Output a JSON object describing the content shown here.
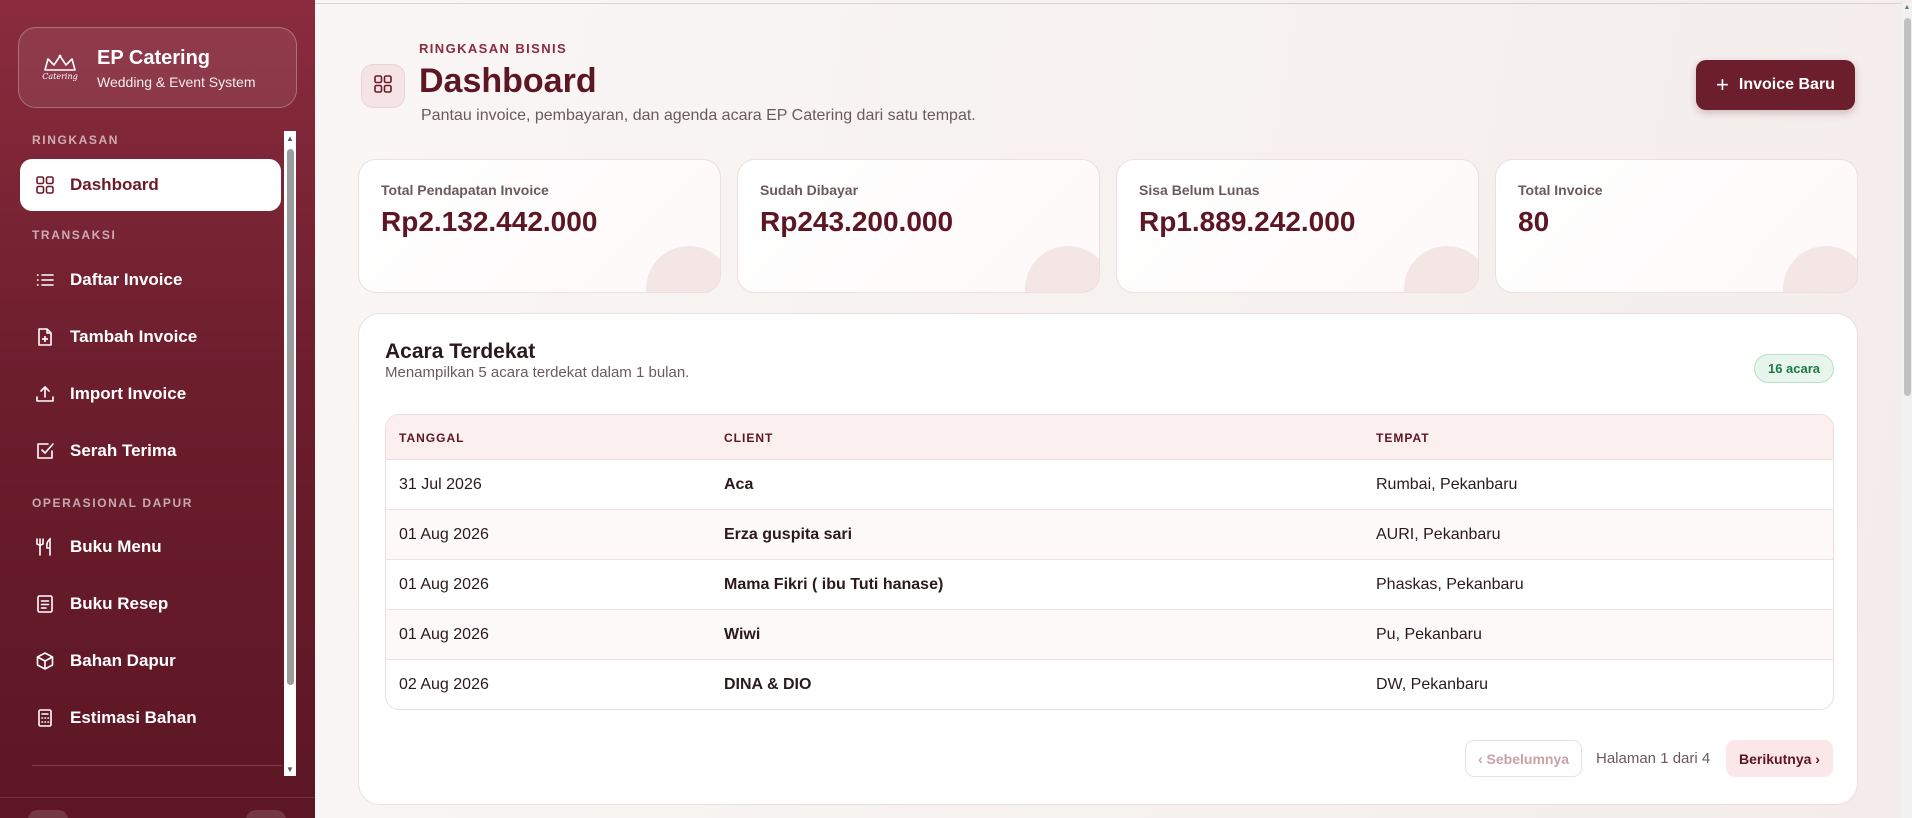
{
  "brand": {
    "title": "EP Catering",
    "subtitle": "Wedding & Event System",
    "logo_word": "Catering"
  },
  "nav": {
    "sections": [
      "RINGKASAN",
      "TRANSAKSI",
      "OPERASIONAL DAPUR"
    ],
    "items": [
      {
        "label": "Dashboard",
        "icon": "grid-icon",
        "active": true
      },
      {
        "label": "Daftar Invoice",
        "icon": "list-icon"
      },
      {
        "label": "Tambah Invoice",
        "icon": "file-plus-icon"
      },
      {
        "label": "Import Invoice",
        "icon": "upload-icon"
      },
      {
        "label": "Serah Terima",
        "icon": "check-square-icon"
      },
      {
        "label": "Buku Menu",
        "icon": "utensils-icon"
      },
      {
        "label": "Buku Resep",
        "icon": "recipe-book-icon"
      },
      {
        "label": "Bahan Dapur",
        "icon": "box-icon"
      },
      {
        "label": "Estimasi Bahan",
        "icon": "calculator-icon"
      }
    ]
  },
  "header": {
    "eyebrow": "RINGKASAN BISNIS",
    "title": "Dashboard",
    "subtitle": "Pantau invoice, pembayaran, dan agenda acara EP Catering dari satu tempat.",
    "new_button": "Invoice Baru"
  },
  "stats": [
    {
      "label": "Total Pendapatan Invoice",
      "value": "Rp2.132.442.000"
    },
    {
      "label": "Sudah Dibayar",
      "value": "Rp243.200.000"
    },
    {
      "label": "Sisa Belum Lunas",
      "value": "Rp1.889.242.000"
    },
    {
      "label": "Total Invoice",
      "value": "80"
    }
  ],
  "events": {
    "title": "Acara Terdekat",
    "subtitle": "Menampilkan 5 acara terdekat dalam 1 bulan.",
    "badge": "16 acara",
    "columns": [
      "TANGGAL",
      "CLIENT",
      "TEMPAT"
    ],
    "rows": [
      {
        "date": "31 Jul 2026",
        "client": "Aca",
        "place": "Rumbai, Pekanbaru"
      },
      {
        "date": "01 Aug 2026",
        "client": "Erza guspita sari",
        "place": "AURI, Pekanbaru"
      },
      {
        "date": "01 Aug 2026",
        "client": "Mama Fikri ( ibu Tuti hanase)",
        "place": "Phaskas, Pekanbaru"
      },
      {
        "date": "01 Aug 2026",
        "client": "Wiwi",
        "place": "Pu, Pekanbaru"
      },
      {
        "date": "02 Aug 2026",
        "client": "DINA & DIO",
        "place": "DW, Pekanbaru"
      }
    ],
    "pagination": {
      "prev": "‹ Sebelumnya",
      "info": "Halaman 1 dari 4",
      "next": "Berikutnya ›"
    }
  },
  "colors": {
    "primary": "#6d1e2d",
    "accent": "#8a2c3e",
    "badge_green": "#1e7a45"
  }
}
